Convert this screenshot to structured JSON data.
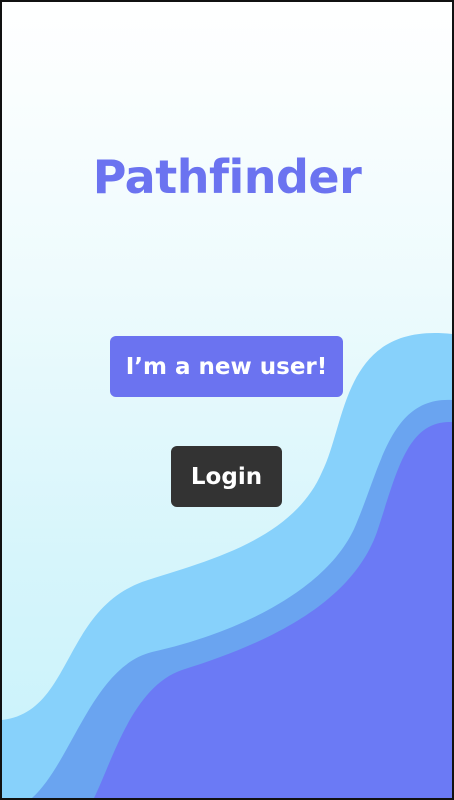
{
  "app": {
    "title": "Pathfinder"
  },
  "actions": {
    "new_user_label": "I’m a new user!",
    "login_label": "Login"
  },
  "colors": {
    "brand": "#6b73f0",
    "login_button": "#333333",
    "wave_light": "#87d1fb",
    "wave_mid": "#6aa4f0",
    "wave_dark": "#6b7af5"
  }
}
